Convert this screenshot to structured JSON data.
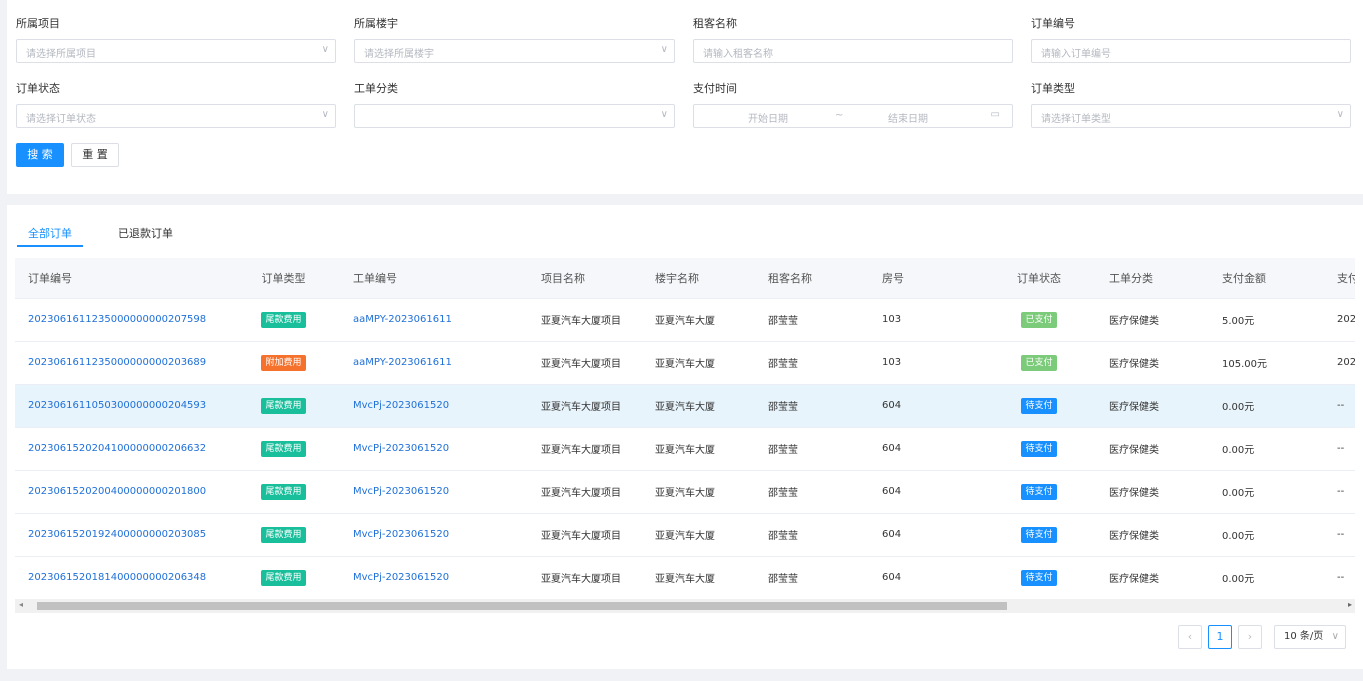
{
  "filters": {
    "project": {
      "label": "所属项目",
      "placeholder": "请选择所属项目"
    },
    "building": {
      "label": "所属楼宇",
      "placeholder": "请选择所属楼宇"
    },
    "tenant": {
      "label": "租客名称",
      "placeholder": "请输入租客名称"
    },
    "order_no": {
      "label": "订单编号",
      "placeholder": "请输入订单编号"
    },
    "order_status": {
      "label": "订单状态",
      "placeholder": "请选择订单状态"
    },
    "ticket_category": {
      "label": "工单分类",
      "placeholder": ""
    },
    "pay_time": {
      "label": "支付时间",
      "start_placeholder": "开始日期",
      "separator": "~",
      "end_placeholder": "结束日期"
    },
    "order_type": {
      "label": "订单类型",
      "placeholder": "请选择订单类型"
    },
    "search_label": "搜 索",
    "reset_label": "重 置"
  },
  "tabs": [
    "全部订单",
    "已退款订单"
  ],
  "table": {
    "columns": [
      "订单编号",
      "订单类型",
      "工单编号",
      "项目名称",
      "楼宇名称",
      "租客名称",
      "房号",
      "订单状态",
      "工单分类",
      "支付金额",
      "支付"
    ],
    "rows": [
      [
        "2023061611235000000000207598",
        "尾款费用",
        "aaMPY-2023061611",
        "亚夏汽车大厦项目",
        "亚夏汽车大厦",
        "邵莹莹",
        "103",
        "已支付",
        "医疗保健类",
        "5.00元",
        "202"
      ],
      [
        "2023061611235000000000203689",
        "附加费用",
        "aaMPY-2023061611",
        "亚夏汽车大厦项目",
        "亚夏汽车大厦",
        "邵莹莹",
        "103",
        "已支付",
        "医疗保健类",
        "105.00元",
        "202"
      ],
      [
        "2023061611050300000000204593",
        "尾款费用",
        "MvcPj-2023061520",
        "亚夏汽车大厦项目",
        "亚夏汽车大厦",
        "邵莹莹",
        "604",
        "待支付",
        "医疗保健类",
        "0.00元",
        "--"
      ],
      [
        "2023061520204100000000206632",
        "尾款费用",
        "MvcPj-2023061520",
        "亚夏汽车大厦项目",
        "亚夏汽车大厦",
        "邵莹莹",
        "604",
        "待支付",
        "医疗保健类",
        "0.00元",
        "--"
      ],
      [
        "2023061520200400000000201800",
        "尾款费用",
        "MvcPj-2023061520",
        "亚夏汽车大厦项目",
        "亚夏汽车大厦",
        "邵莹莹",
        "604",
        "待支付",
        "医疗保健类",
        "0.00元",
        "--"
      ],
      [
        "2023061520192400000000203085",
        "尾款费用",
        "MvcPj-2023061520",
        "亚夏汽车大厦项目",
        "亚夏汽车大厦",
        "邵莹莹",
        "604",
        "待支付",
        "医疗保健类",
        "0.00元",
        "--"
      ],
      [
        "2023061520181400000000206348",
        "尾款费用",
        "MvcPj-2023061520",
        "亚夏汽车大厦项目",
        "亚夏汽车大厦",
        "邵莹莹",
        "604",
        "待支付",
        "医疗保健类",
        "0.00元",
        "--"
      ]
    ]
  },
  "tag_colors": {
    "尾款费用": "#19be9b",
    "附加费用": "#f5712c",
    "已支付": "#7ccb7a",
    "待支付": "#1890ff"
  },
  "pagination": {
    "prev_icon": "‹",
    "current_page": "1",
    "next_icon": "›",
    "page_size": "10 条/页"
  },
  "icons": {
    "select_chevron": "chevron-down-icon",
    "date": "calendar-icon",
    "scroll_left": "arrow-left-icon",
    "scroll_right": "arrow-right-icon"
  }
}
